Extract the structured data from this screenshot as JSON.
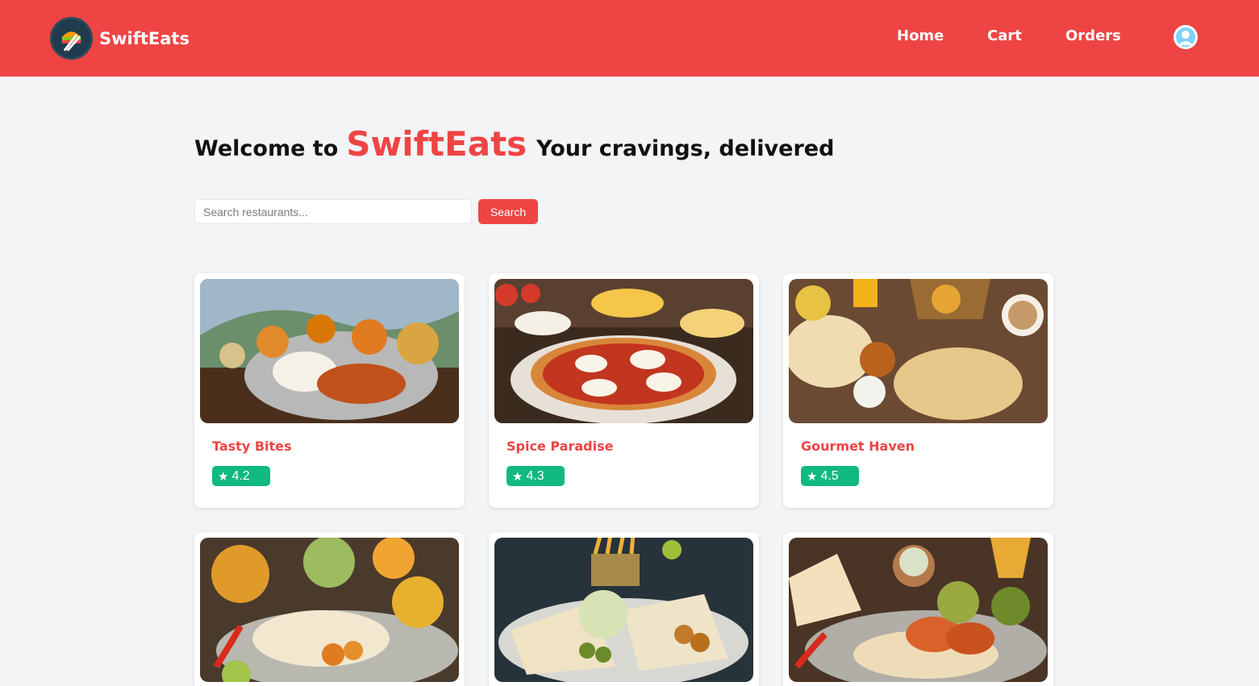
{
  "brand": {
    "name": "SwiftEats",
    "color": "#ef4444"
  },
  "nav": {
    "home_label": "Home",
    "cart_label": "Cart",
    "orders_label": "Orders",
    "profile_icon": "user-circle-icon"
  },
  "hero": {
    "prefix": "Welcome to",
    "brand": "SwiftEats",
    "tagline": "Your cravings, delivered"
  },
  "search": {
    "placeholder": "Search restaurants...",
    "button_label": "Search"
  },
  "restaurants": [
    {
      "name": "Tasty Bites",
      "rating": "4.2"
    },
    {
      "name": "Spice Paradise",
      "rating": "4.3"
    },
    {
      "name": "Gourmet Haven",
      "rating": "4.5"
    },
    {
      "name": "",
      "rating": ""
    },
    {
      "name": "",
      "rating": ""
    },
    {
      "name": "",
      "rating": ""
    }
  ],
  "colors": {
    "accent": "#ef4444",
    "rating_badge": "#10b981",
    "background": "#f3f4f6"
  }
}
